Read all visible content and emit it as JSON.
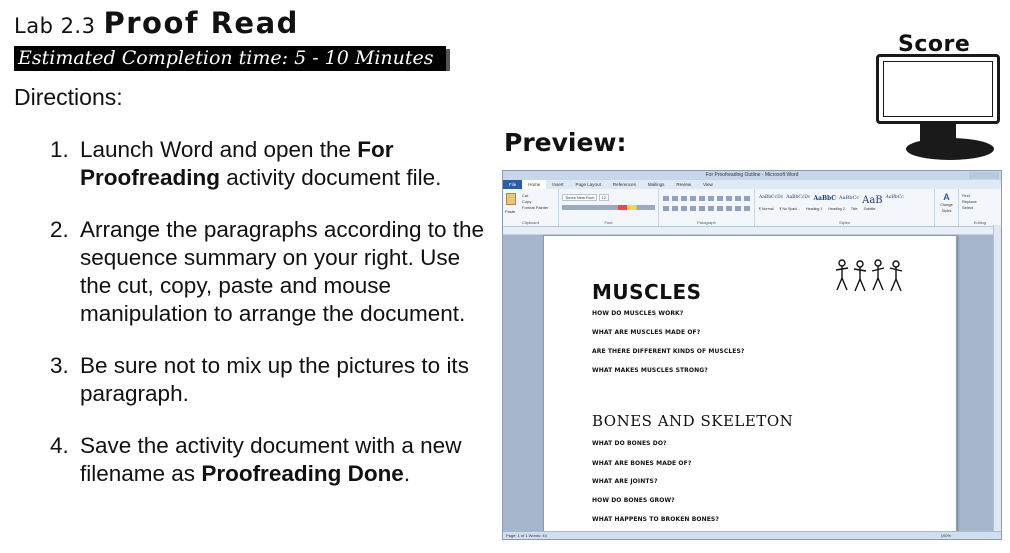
{
  "header": {
    "lab_number": "Lab 2.3",
    "lab_title": "Proof Read",
    "estimated_time": "Estimated Completion time: 5 - 10 Minutes",
    "directions_label": "Directions:"
  },
  "steps": [
    {
      "num": "1.",
      "pre": "Launch Word and open the ",
      "bold": "For Proofreading",
      "post": " activity document file."
    },
    {
      "num": "2.",
      "pre": "Arrange the paragraphs according to the sequence summary on your right. Use the cut, copy, paste and mouse manipulation to arrange the document.",
      "bold": "",
      "post": ""
    },
    {
      "num": "3.",
      "pre": "Be sure not to mix up the pictures to its paragraph.",
      "bold": "",
      "post": ""
    },
    {
      "num": "4.",
      "pre": "Save the activity document with a new filename as ",
      "bold": "Proofreading Done",
      "post": "."
    }
  ],
  "score": {
    "label": "Score"
  },
  "preview": {
    "label": "Preview:",
    "window_title": "For Proofreading Outline - Microsoft Word",
    "tabs": [
      "File",
      "Home",
      "Insert",
      "Page Layout",
      "References",
      "Mailings",
      "Review",
      "View"
    ],
    "ribbon_groups": [
      "Clipboard",
      "Font",
      "Paragraph",
      "Styles",
      "Editing"
    ],
    "clipboard_items": [
      "Cut",
      "Copy",
      "Format Painter",
      "Paste"
    ],
    "font_name": "Times New Rom",
    "font_size": "12",
    "styles": [
      "AaBbCcDc",
      "AaBbCcDc",
      "AaBbC",
      "AaBbCc",
      "AaB",
      "AaBbCc"
    ],
    "style_names": [
      "¶ Normal",
      "¶ No Spaci...",
      "Heading 1",
      "Heading 2",
      "Title",
      "Subtitle"
    ],
    "editing_items": [
      "Find",
      "Replace",
      "Select"
    ],
    "change_styles": "Change Styles",
    "status_left": "Page: 1 of 1   Words: 44",
    "zoom": "100%",
    "document": {
      "heading1": "MUSCLES",
      "questions1": [
        "HOW DO MUSCLES WORK?",
        "WHAT ARE MUSCLES MADE OF?",
        "ARE THERE DIFFERENT KINDS OF MUSCLES?",
        "WHAT MAKES MUSCLES STRONG?"
      ],
      "heading2": "BONES AND SKELETON",
      "questions2": [
        "WHAT DO BONES DO?",
        "WHAT ARE BONES MADE OF?",
        "WHAT ARE JOINTS?",
        "HOW DO BONES GROW?",
        "WHAT HAPPENS TO BROKEN BONES?"
      ]
    }
  }
}
